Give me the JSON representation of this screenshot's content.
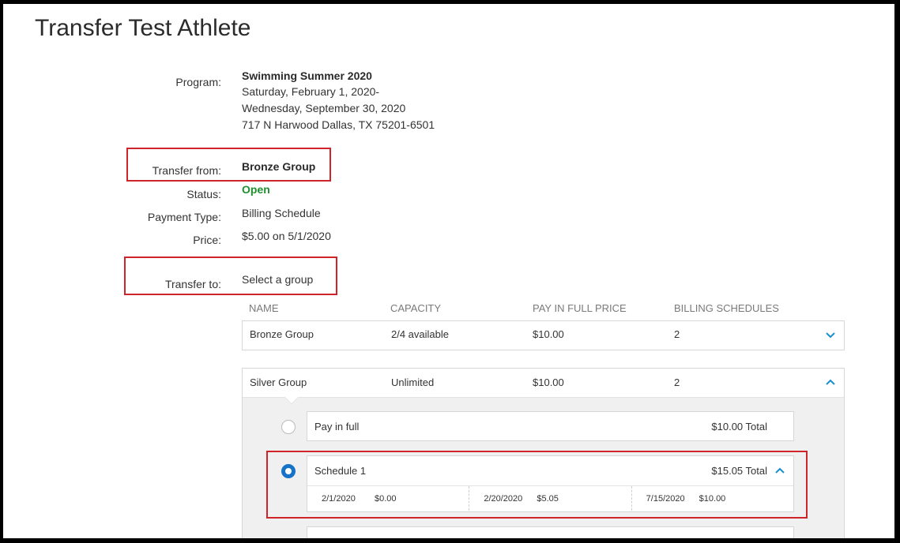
{
  "page": {
    "title": "Transfer Test Athlete"
  },
  "program": {
    "label": "Program:",
    "name": "Swimming Summer 2020",
    "date_start": "Saturday, February 1, 2020-",
    "date_end": "Wednesday, September 30, 2020",
    "address": "717 N Harwood Dallas, TX 75201-6501"
  },
  "transfer_from": {
    "label": "Transfer from:",
    "value": "Bronze Group",
    "status_label": "Status:",
    "status_value": "Open",
    "payment_type_label": "Payment Type:",
    "payment_type_value": "Billing Schedule",
    "price_label": "Price:",
    "price_value": "$5.00 on 5/1/2020"
  },
  "transfer_to": {
    "label": "Transfer to:",
    "value": "Select a group"
  },
  "columns": [
    "NAME",
    "CAPACITY",
    "PAY IN FULL PRICE",
    "BILLING SCHEDULES"
  ],
  "groups": [
    {
      "name": "Bronze Group",
      "capacity": "2/4 available",
      "price": "$10.00",
      "schedules": "2",
      "expanded": false
    },
    {
      "name": "Silver Group",
      "capacity": "Unlimited",
      "price": "$10.00",
      "schedules": "2",
      "expanded": true
    }
  ],
  "payment_options": {
    "pay_in_full": {
      "label": "Pay in full",
      "total": "$10.00 Total",
      "selected": false
    },
    "schedule_1": {
      "label": "Schedule 1",
      "total": "$15.05 Total",
      "selected": true,
      "installments": [
        {
          "date": "2/1/2020",
          "amount": "$0.00"
        },
        {
          "date": "2/20/2020",
          "amount": "$5.05"
        },
        {
          "date": "7/15/2020",
          "amount": "$10.00"
        }
      ]
    }
  },
  "colors": {
    "accent": "#1673c8",
    "highlight": "#d0242b",
    "status_open": "#1e8f2e"
  }
}
